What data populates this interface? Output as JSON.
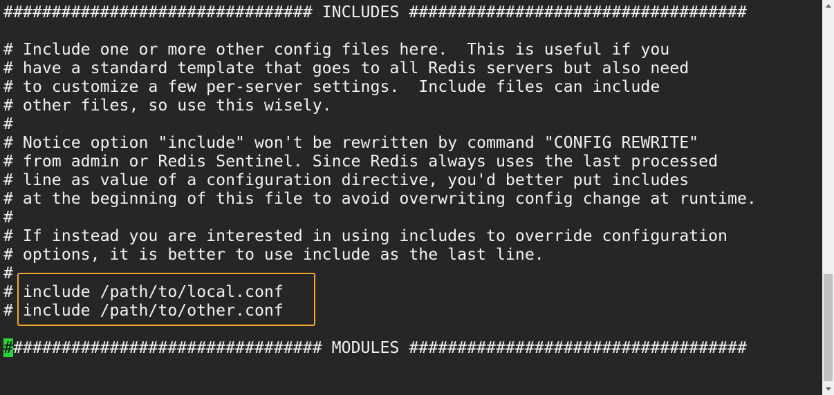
{
  "terminal": {
    "lines": [
      "################################ INCLUDES ###################################",
      "",
      "# Include one or more other config files here.  This is useful if you",
      "# have a standard template that goes to all Redis servers but also need",
      "# to customize a few per-server settings.  Include files can include",
      "# other files, so use this wisely.",
      "#",
      "# Notice option \"include\" won't be rewritten by command \"CONFIG REWRITE\"",
      "# from admin or Redis Sentinel. Since Redis always uses the last processed",
      "# line as value of a configuration directive, you'd better put includes",
      "# at the beginning of this file to avoid overwriting config change at runtime.",
      "#",
      "# If instead you are interested in using includes to override configuration",
      "# options, it is better to use include as the last line.",
      "#",
      "# include /path/to/local.conf",
      "# include /path/to/other.conf",
      "",
      {
        "cursor_char": "#",
        "rest": "################################ MODULES ###################################"
      }
    ],
    "colors": {
      "background": "#262626",
      "text": "#f2f2f2",
      "cursor": "#28d43a",
      "highlight_border": "#f0a92b",
      "scrollbar_track": "#f0f0f0",
      "scrollbar_thumb": "#c1c1c1"
    }
  },
  "scrollbar": {
    "up_icon": "triangle-up",
    "down_icon": "triangle-down",
    "scroll_fraction": 0.72
  }
}
